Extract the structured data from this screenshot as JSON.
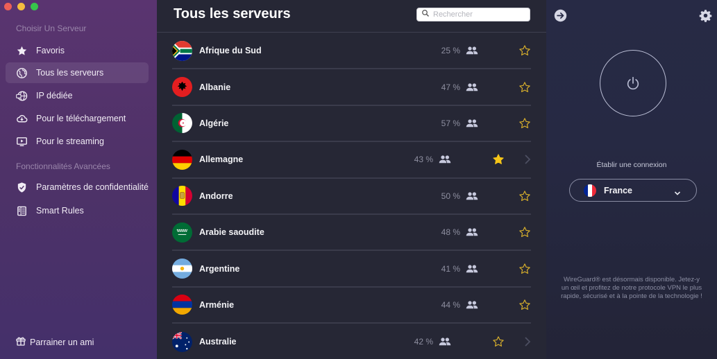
{
  "window": {
    "controls": [
      "close",
      "minimize",
      "zoom"
    ]
  },
  "sidebar": {
    "section_choose": "Choisir Un Serveur",
    "items": [
      {
        "label": "Favoris",
        "icon": "star-icon",
        "active": false
      },
      {
        "label": "Tous les serveurs",
        "icon": "globe-icon",
        "active": true
      },
      {
        "label": "IP dédiée",
        "icon": "dedicated-ip-icon",
        "active": false
      },
      {
        "label": "Pour le téléchargement",
        "icon": "cloud-download-icon",
        "active": false
      },
      {
        "label": "Pour le streaming",
        "icon": "tv-play-icon",
        "active": false
      }
    ],
    "section_advanced": "Fonctionnalités Avancées",
    "advanced_items": [
      {
        "label": "Paramètres de confidentialité",
        "icon": "shield-check-icon"
      },
      {
        "label": "Smart Rules",
        "icon": "rules-icon"
      }
    ],
    "referral": {
      "label": "Parrainer un ami",
      "icon": "gift-icon"
    }
  },
  "main": {
    "title": "Tous les serveurs",
    "search": {
      "placeholder": "Rechercher",
      "value": ""
    },
    "servers": [
      {
        "country": "Afrique du Sud",
        "load": "25 %",
        "favorite": false,
        "arrow": false,
        "flag": "za"
      },
      {
        "country": "Albanie",
        "load": "47 %",
        "favorite": false,
        "arrow": false,
        "flag": "al"
      },
      {
        "country": "Algérie",
        "load": "57 %",
        "favorite": false,
        "arrow": false,
        "flag": "dz"
      },
      {
        "country": "Allemagne",
        "load": "43 %",
        "favorite": true,
        "arrow": true,
        "flag": "de"
      },
      {
        "country": "Andorre",
        "load": "50 %",
        "favorite": false,
        "arrow": false,
        "flag": "ad"
      },
      {
        "country": "Arabie saoudite",
        "load": "48 %",
        "favorite": false,
        "arrow": false,
        "flag": "sa"
      },
      {
        "country": "Argentine",
        "load": "41 %",
        "favorite": false,
        "arrow": false,
        "flag": "ar"
      },
      {
        "country": "Arménie",
        "load": "44 %",
        "favorite": false,
        "arrow": false,
        "flag": "am"
      },
      {
        "country": "Australie",
        "load": "42 %",
        "favorite": false,
        "arrow": true,
        "flag": "au"
      }
    ]
  },
  "panel": {
    "connection_label": "Établir une connexion",
    "location": {
      "name": "France",
      "flag": "fr"
    },
    "promo": "WireGuard® est désormais disponible. Jetez-y un œil et profitez de notre protocole VPN le plus rapide, sécurisé et à la pointe de la technologie !"
  },
  "colors": {
    "accent_star": "#f5c518",
    "sidebar_bg": "#4f3268",
    "main_bg": "#262735",
    "panel_bg": "#272a45"
  }
}
